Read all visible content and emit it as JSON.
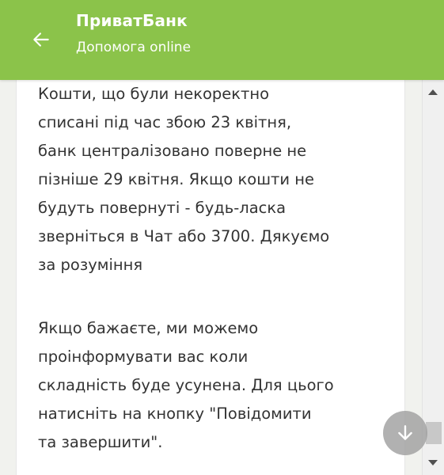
{
  "header": {
    "title": "ПриватБанк",
    "subtitle": "Допомога online",
    "back_icon": "arrow-left-icon",
    "background_color": "#8bc34a"
  },
  "chat": {
    "message_1": "Кошти, що були некоректно\nсписані під час збою 23 квітня,\nбанк централізовано поверне не\nпізніше 29 квітня. Якщо кошти не\nбудуть повернуті - будь-ласка\nзверніться в Чат або 3700. Дякуємо\nза розуміння",
    "message_2": "Якщо бажаєте, ми можемо\nпроінформувати вас коли\nскладність буде усунена. Для цього\nнатисніть на кнопку \"Повідомити\nта завершити\"."
  },
  "scroll_down_button": {
    "icon": "arrow-down-icon"
  },
  "scrollbar": {
    "up_icon": "scroll-up-arrow-icon",
    "down_icon": "scroll-down-arrow-icon"
  }
}
